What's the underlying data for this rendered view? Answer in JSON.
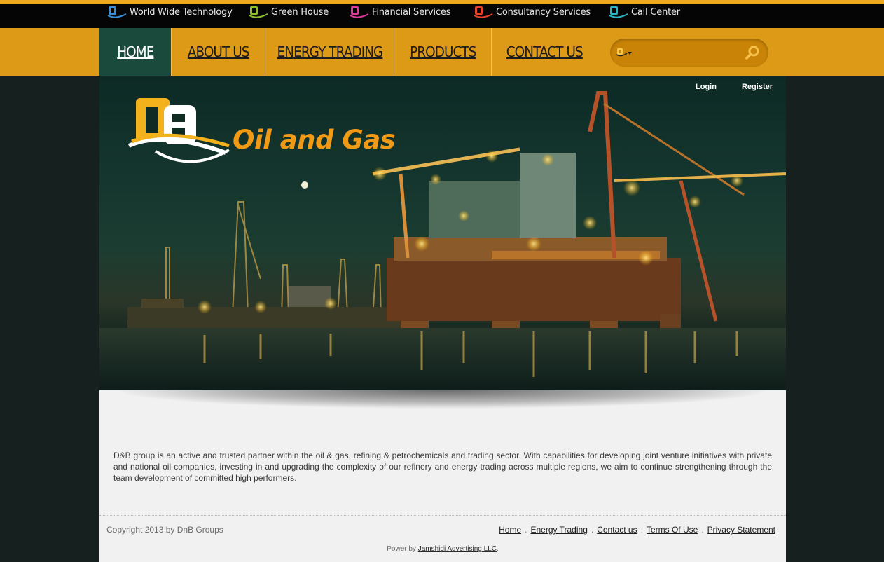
{
  "sister_sites": [
    {
      "label": "World Wide Technology",
      "color": "#3a8fd8"
    },
    {
      "label": "Green House",
      "color": "#8cbf2a"
    },
    {
      "label": "Financial Services",
      "color": "#e03a9a"
    },
    {
      "label": "Consultancy Services",
      "color": "#e8422a"
    },
    {
      "label": "Call Center",
      "color": "#28b6c8"
    }
  ],
  "nav": {
    "items": [
      {
        "label": "HOME",
        "active": true
      },
      {
        "label": "ABOUT US",
        "active": false
      },
      {
        "label": "ENERGY TRADING",
        "active": false
      },
      {
        "label": "PRODUCTS",
        "active": false
      },
      {
        "label": "CONTACT US",
        "active": false
      }
    ]
  },
  "search": {
    "placeholder": "",
    "value": "",
    "button_icon": "magnifier-icon",
    "dropdown_icon": "db-logo-dropdown-icon"
  },
  "auth": {
    "login": "Login",
    "register": "Register"
  },
  "brand": {
    "title": "Oil and Gas",
    "accent": "#f19a15"
  },
  "intro": "D&B group is an active and trusted partner within the oil & gas, refining & petrochemicals and trading sector. With capabilities for developing joint venture initiatives with private and national oil companies, investing in and upgrading the complexity of our refinery and energy trading across multiple regions, we aim to continue strengthening through the team development of committed high performers.",
  "footer": {
    "copyright": "Copyright 2013 by DnB Groups",
    "links": [
      "Home",
      "Energy Trading",
      "Contact us",
      "Terms Of Use",
      "Privacy Statement"
    ],
    "powered_prefix": "Power by",
    "powered_link": "Jamshidi Advertising LLC",
    "powered_suffix": "."
  },
  "colors": {
    "nav_bg": "#dd9a16",
    "nav_active": "#1a4a3c",
    "top_strip": "#f2a81e",
    "page_bg": "#16201f"
  }
}
